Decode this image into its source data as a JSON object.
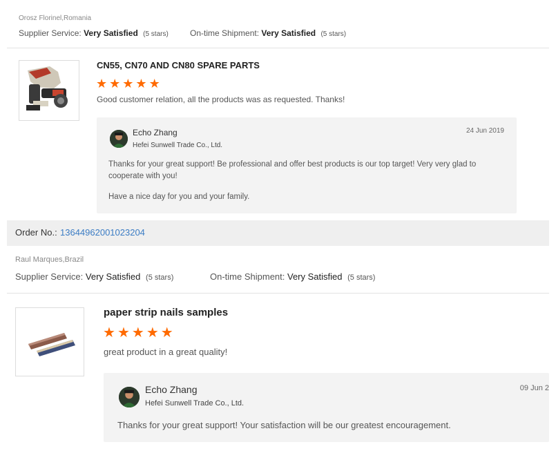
{
  "review1": {
    "buyer": "Orosz Florinel,Romania",
    "supplier_service_label": "Supplier Service:",
    "supplier_service_value": "Very Satisfied",
    "supplier_service_stars": "(5 stars)",
    "shipment_label": "On-time Shipment:",
    "shipment_value": "Very Satisfied",
    "shipment_stars": "(5 stars)",
    "product_title": "CN55, CN70 AND CN80 SPARE PARTS",
    "rating": 5,
    "comment": "Good customer relation, all the products was as requested. Thanks!",
    "reply": {
      "name": "Echo Zhang",
      "company": "Hefei Sunwell Trade Co., Ltd.",
      "date": "24 Jun 2019",
      "text1": "Thanks for your great support! Be professional and offer best products is our top target! Very very glad to cooperate with you!",
      "text2": "Have a nice day for you and your family."
    }
  },
  "order_bar": {
    "label": "Order No.:",
    "number": "13644962001023204"
  },
  "review2": {
    "buyer": "Raul Marques,Brazil",
    "supplier_service_label": "Supplier Service:",
    "supplier_service_value": "Very Satisfied",
    "supplier_service_stars": "(5 stars)",
    "shipment_label": "On-time Shipment:",
    "shipment_value": "Very Satisfied",
    "shipment_stars": "(5 stars)",
    "product_title": "paper strip nails samples",
    "rating": 5,
    "comment": "great product in a great quality!",
    "reply": {
      "name": "Echo Zhang",
      "company": "Hefei Sunwell Trade Co., Ltd.",
      "date": "09 Jun 2",
      "text1": "Thanks for your great support! Your satisfaction will be our greatest encouragement."
    }
  },
  "colors": {
    "star": "#ff6a00",
    "order_link": "#3b7cc4",
    "reply_bg": "#f3f3f3",
    "order_bg": "#efefef"
  }
}
